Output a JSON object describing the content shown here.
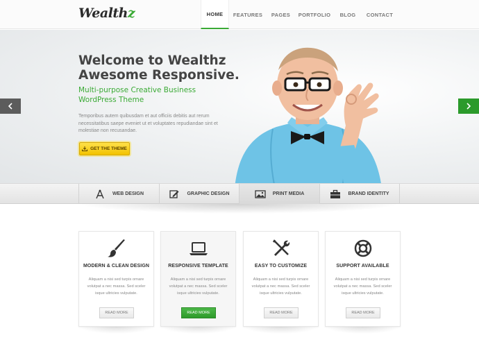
{
  "logo": {
    "text": "Wealth",
    "accent": "z"
  },
  "nav": {
    "items": [
      {
        "label": "HOME",
        "active": true
      },
      {
        "label": "FEATURES"
      },
      {
        "label": "PAGES"
      },
      {
        "label": "PORTFOLIO"
      },
      {
        "label": "BLOG"
      },
      {
        "label": "CONTACT"
      }
    ]
  },
  "hero": {
    "title_line1": "Welcome to Wealthz",
    "title_line2": "Awesome Responsive.",
    "subtitle_line1": "Multi-purpose Creative Business",
    "subtitle_line2": "WordPress Theme",
    "text": "Temporibus autem quibusdam et aut officiis debitis aut rerum necessitatibus saepe eveniet ut et voluptates repudiandae sint et molestiae non recusandae.",
    "cta_label": "GET THE THEME"
  },
  "categories": [
    {
      "label": "WEB DESIGN",
      "icon": "compass-ruler-icon"
    },
    {
      "label": "GRAPHIC DESIGN",
      "icon": "edit-pencil-icon"
    },
    {
      "label": "PRINT MEDIA",
      "icon": "image-icon",
      "active": true
    },
    {
      "label": "BRAND IDENTITY",
      "icon": "briefcase-icon"
    }
  ],
  "features": [
    {
      "title": "MODERN & CLEAN DESIGN",
      "icon": "paintbrush-icon",
      "text": "Aliquam a nisi sed turpis ornare volutpat a nec massa. Sed sceler isque ultricies vulputate.",
      "button": "READ MORE"
    },
    {
      "title": "RESPONSIVE TEMPLATE",
      "icon": "laptop-icon",
      "text": "Aliquam a nisi sed turpis ornare volutpat a nec massa. Sed sceler isque ultricies vulputate.",
      "button": "READ MORE"
    },
    {
      "title": "EASY TO CUSTOMIZE",
      "icon": "tools-icon",
      "text": "Aliquam a nisi sed turpis ornare volutpat a nec massa. Sed sceler isque ultricies vulputate.",
      "button": "READ MORE"
    },
    {
      "title": "SUPPORT AVAILABLE",
      "icon": "lifebuoy-icon",
      "text": "Aliquam a nisi sed turpis ornare volutpat a nec massa. Sed sceler isque ultricies vulputate.",
      "button": "READ MORE"
    }
  ],
  "colors": {
    "accent": "#3aaa35",
    "cta": "#f5c800",
    "slider_prev": "#5c5c5c",
    "slider_next": "#2b9a2b"
  }
}
